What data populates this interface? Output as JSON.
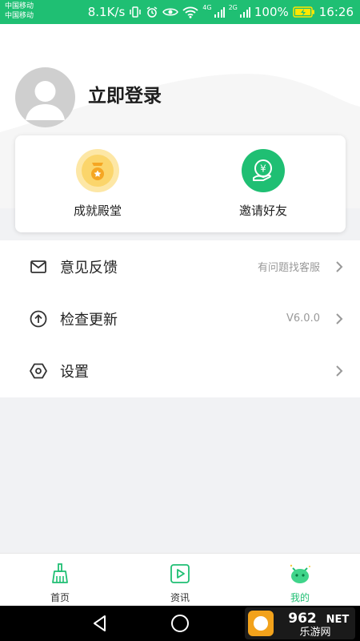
{
  "status_bar": {
    "carrier1": "中国移动",
    "carrier2": "中国移动",
    "net_speed": "8.1K/s",
    "net1": "4G",
    "net2": "2G",
    "battery": "100%",
    "time": "16:26"
  },
  "profile": {
    "login_text": "立即登录",
    "avatar_icon": "user-icon"
  },
  "quick_actions": [
    {
      "label": "成就殿堂",
      "icon": "medal-icon",
      "color": "#fbd56b"
    },
    {
      "label": "邀请好友",
      "icon": "yen-hand-icon",
      "color": "#1fbf73"
    }
  ],
  "menu": {
    "feedback": {
      "label": "意见反馈",
      "value": "有问题找客服",
      "icon": "mail-icon"
    },
    "update": {
      "label": "检查更新",
      "value": "V6.0.0",
      "icon": "upload-arrow-icon"
    },
    "settings": {
      "label": "设置",
      "value": "",
      "icon": "hexagon-settings-icon"
    }
  },
  "tabs": [
    {
      "label": "首页",
      "icon": "broom-icon",
      "active": false
    },
    {
      "label": "资讯",
      "icon": "play-square-icon",
      "active": false
    },
    {
      "label": "我的",
      "icon": "monster-face-icon",
      "active": true
    }
  ],
  "watermark": {
    "top": "962",
    "tld": "NET",
    "bottom": "乐游网"
  },
  "colors": {
    "accent": "#1fbf73",
    "medal": "#fbd56b",
    "background": "#f1f2f4"
  }
}
